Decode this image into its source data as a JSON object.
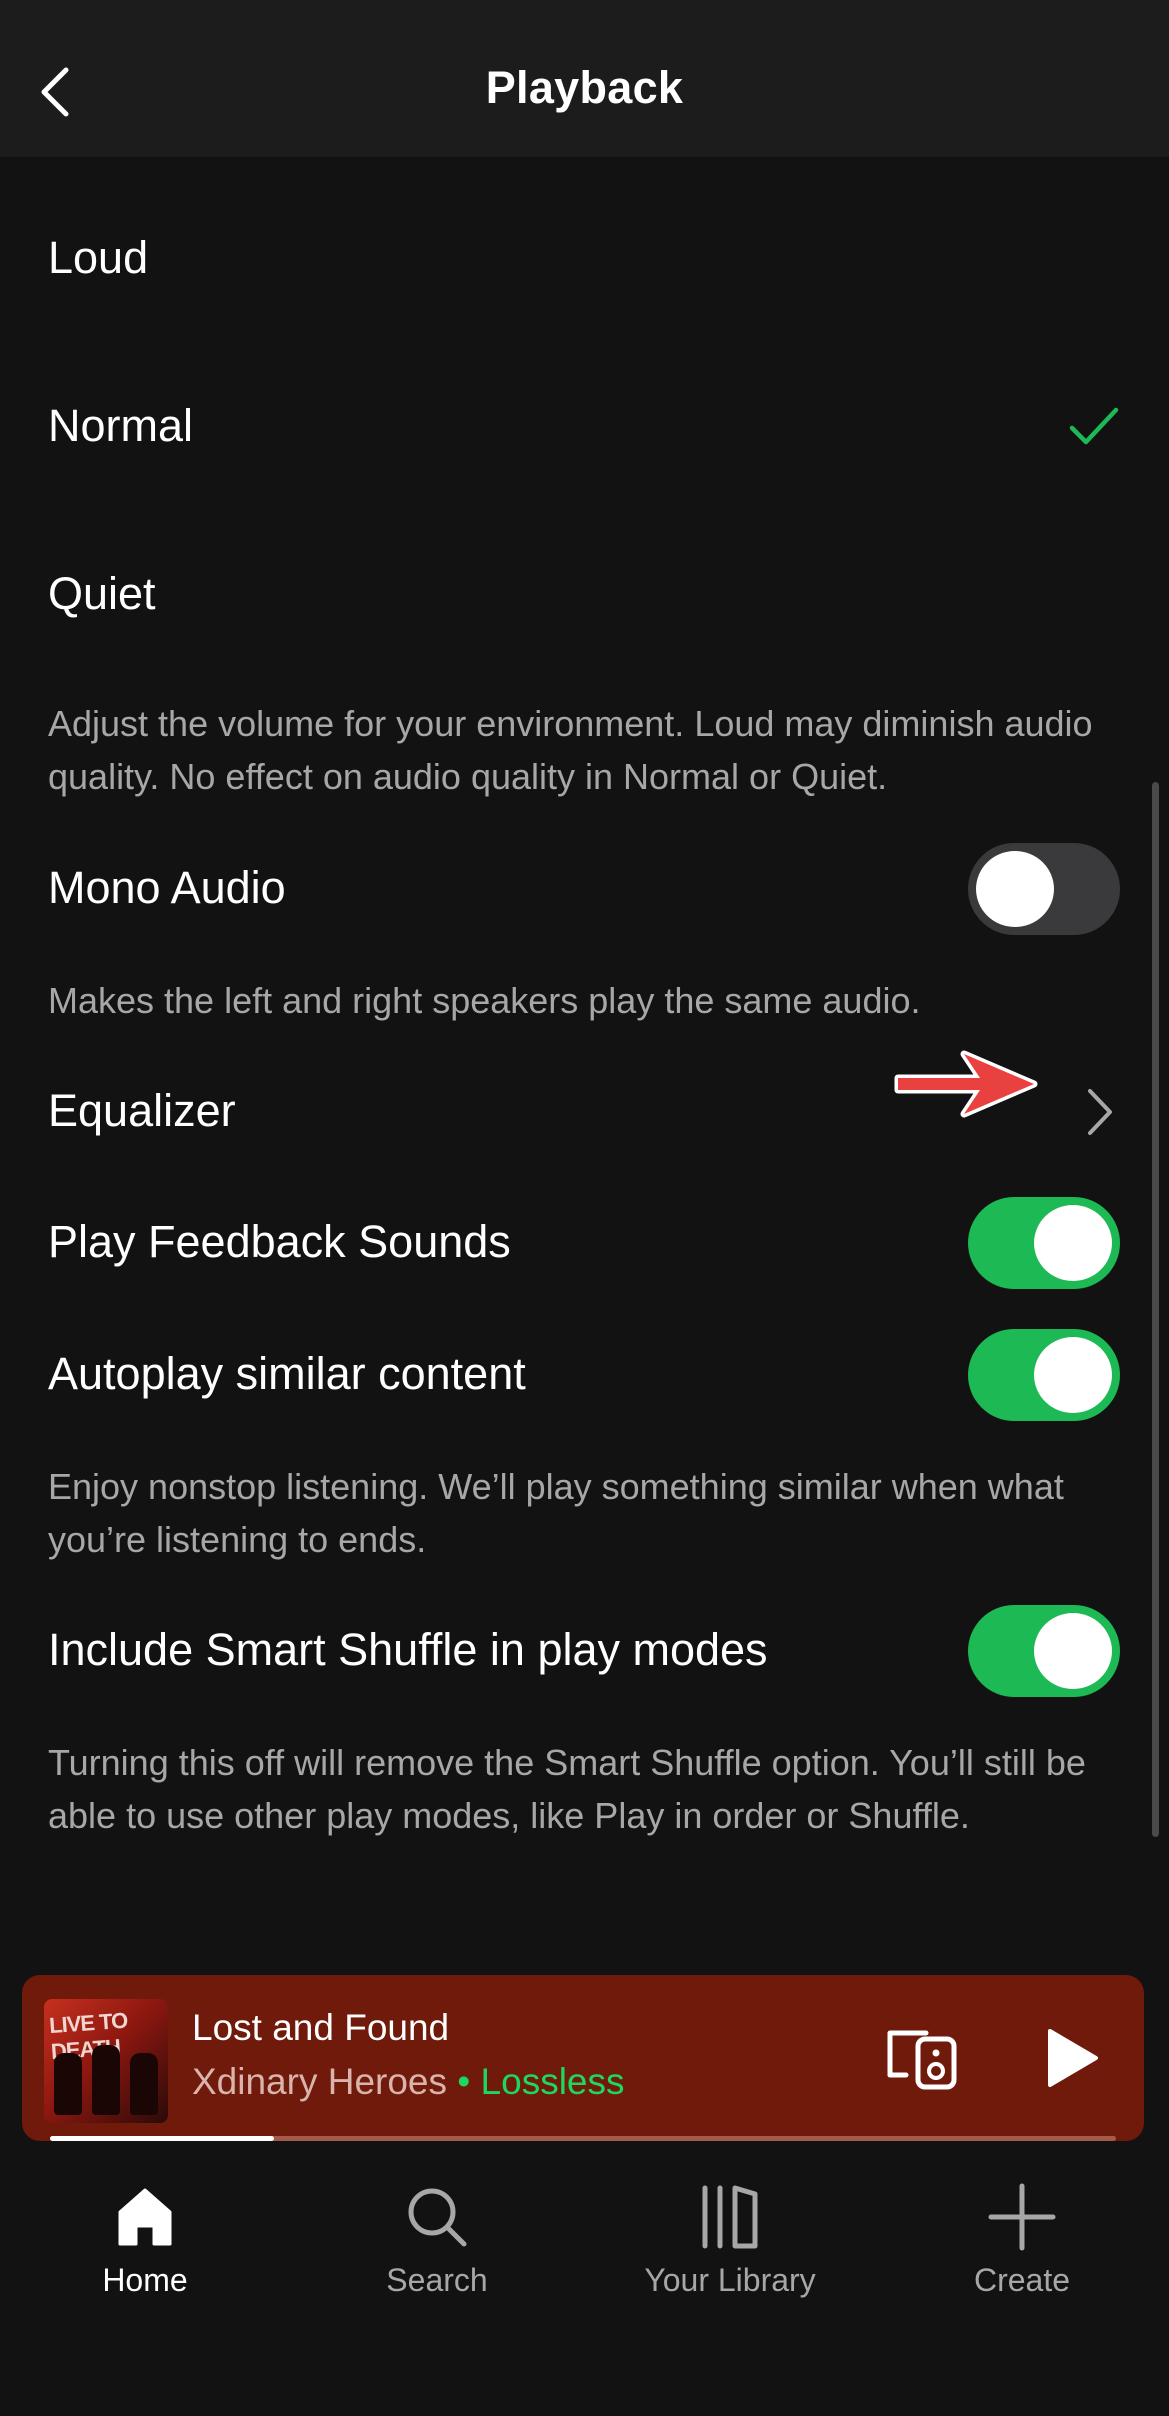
{
  "header": {
    "title": "Playback"
  },
  "volume_levels": {
    "options": [
      {
        "label": "Loud"
      },
      {
        "label": "Normal"
      },
      {
        "label": "Quiet"
      }
    ],
    "selected": "Normal",
    "description": "Adjust the volume for your environment. Loud may diminish audio quality. No effect on audio quality in Normal or Quiet."
  },
  "settings": {
    "mono_audio": {
      "label": "Mono Audio",
      "enabled": false,
      "description": "Makes the left and right speakers play the same audio."
    },
    "equalizer": {
      "label": "Equalizer"
    },
    "play_feedback_sounds": {
      "label": "Play Feedback Sounds",
      "enabled": true
    },
    "autoplay": {
      "label": "Autoplay similar content",
      "enabled": true,
      "description": "Enjoy nonstop listening. We’ll play something similar when what you’re listening to ends."
    },
    "smart_shuffle": {
      "label": "Include Smart Shuffle in play modes",
      "enabled": true,
      "description": "Turning this off will remove the Smart Shuffle option. You’ll still be able to use other play modes, like Play in order or Shuffle."
    }
  },
  "now_playing": {
    "art_text": "LIVE TO DEATH",
    "title": "Lost and Found",
    "artist": "Xdinary Heroes",
    "separator": "•",
    "quality": "Lossless",
    "progress": 0.21
  },
  "nav": {
    "items": [
      {
        "label": "Home",
        "active": true
      },
      {
        "label": "Search",
        "active": false
      },
      {
        "label": "Your Library",
        "active": false
      },
      {
        "label": "Create",
        "active": false
      }
    ]
  },
  "colors": {
    "accent": "#1db954",
    "background": "#121212",
    "player": "#6f1a0a",
    "annotation_arrow": "#e8413f"
  }
}
